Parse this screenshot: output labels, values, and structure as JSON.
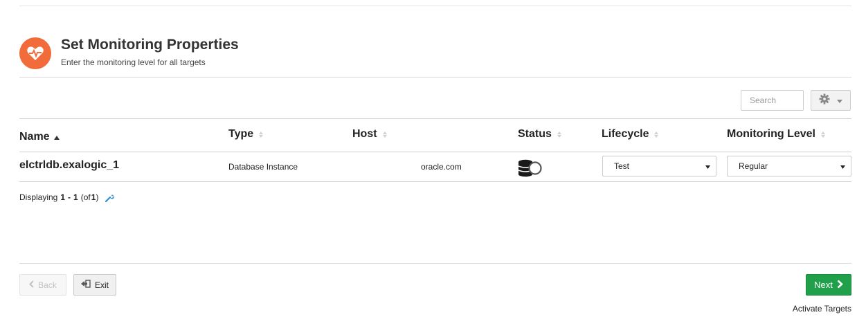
{
  "header": {
    "title": "Set Monitoring Properties",
    "subtitle": "Enter the monitoring level for all targets",
    "icon": "heart-pulse-icon",
    "icon_color": "#f26b3a"
  },
  "toolbar": {
    "search_placeholder": "Search",
    "settings_icon": "gear-icon"
  },
  "table": {
    "columns": [
      "Name",
      "Type",
      "Host",
      "Status",
      "Lifecycle",
      "Monitoring Level"
    ],
    "sorted_column": "Name",
    "rows": [
      {
        "name": "elctrldb.exalogic_1",
        "type": "Database Instance",
        "host": "oracle.com",
        "status_icon": "database-status-icon",
        "lifecycle": "Test",
        "monitoring_level": "Regular"
      }
    ]
  },
  "pagination": {
    "prefix": "Displaying",
    "start": "1",
    "separator": "-",
    "end": "1",
    "of_open": "(of",
    "total": "1",
    "of_close": ")"
  },
  "footer": {
    "back_label": "Back",
    "exit_label": "Exit",
    "next_label": "Next",
    "step_label": "Activate Targets",
    "next_color": "#21a04b"
  }
}
